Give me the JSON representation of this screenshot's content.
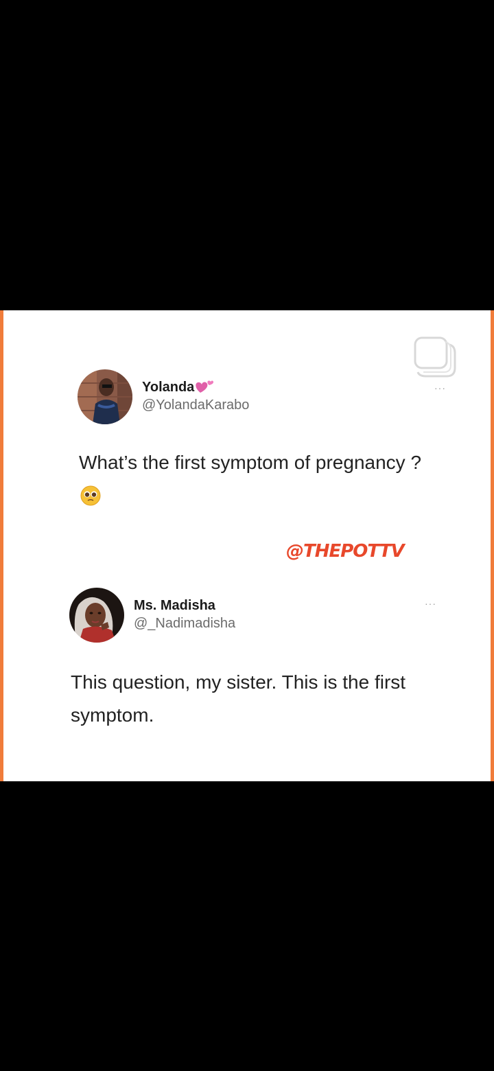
{
  "tweets": [
    {
      "display_name": "Yolanda",
      "handle": "@YolandaKarabo",
      "text": "What’s the first symptom of pregnancy ?"
    },
    {
      "display_name": "Ms. Madisha",
      "handle": "@_Nadimadisha",
      "text": "This question, my sister. This is the first symptom."
    }
  ],
  "watermark": "@THEPOTTV",
  "more_label": "···",
  "icons": {
    "copy": "copy-icon",
    "heart": "two-hearts-icon",
    "emoji": "pleading-face-icon"
  },
  "colors": {
    "frame_border": "#f07c3a",
    "watermark": "#e8482b",
    "background": "#000000"
  }
}
